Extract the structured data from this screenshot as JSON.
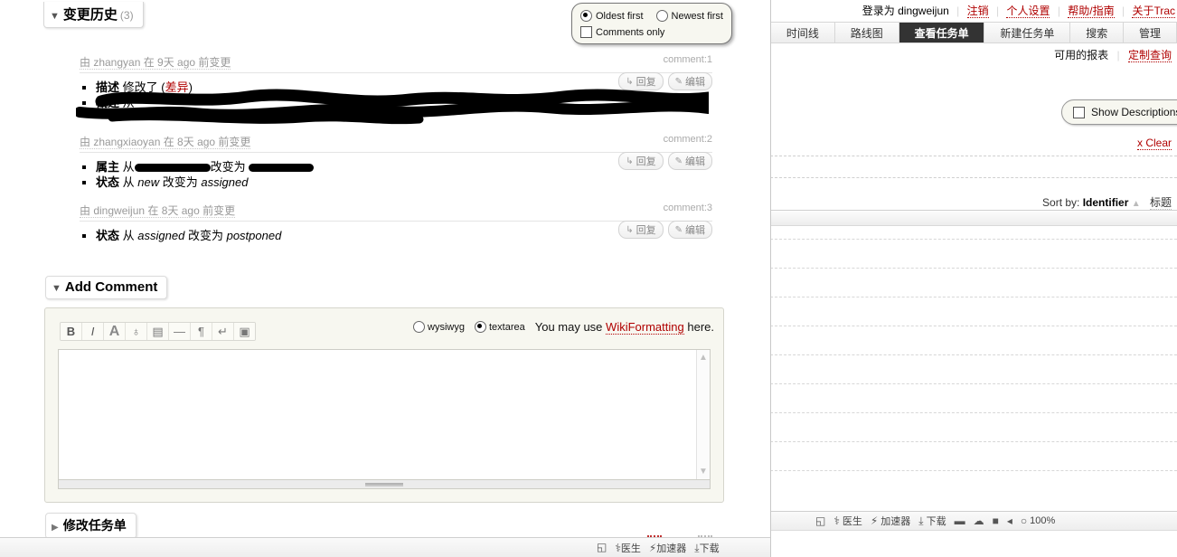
{
  "front_window": {
    "change_history": {
      "title": "变更历史",
      "count": "(3)",
      "toggle_icon": "triangle-down-icon"
    },
    "options_panel": {
      "oldest_first": "Oldest first",
      "newest_first": "Newest first",
      "comments_only": "Comments only",
      "oldest_selected": true,
      "newest_selected": false,
      "comments_only_checked": false
    },
    "reply_label": "回复",
    "edit_label": "编辑",
    "reply_icon": "reply-arrow-icon",
    "edit_icon": "pencil-icon",
    "changes": [
      {
        "header": "由 zhangyan 在 9天 ago 前变更",
        "author": "zhangyan",
        "comment_id": "comment:1",
        "entries": [
          {
            "field": "描述",
            "text": "修改了 (",
            "link": "差异",
            "text_after": ")"
          },
          {
            "field": "概述",
            "text": "从 ▓▓▓▓▓▓ 改变为 ▓▓▓▓▓▓",
            "redacted": true
          }
        ]
      },
      {
        "header": "由 zhangxiaoyan 在 8天 ago 前变更",
        "author": "zhangxiaoyan",
        "comment_id": "comment:2",
        "entries": [
          {
            "field": "属主",
            "text": "从 ▓▓▓▓▓▓ 改变为 ▓▓▓▓▓▓",
            "redacted": true
          },
          {
            "field": "状态",
            "from": "new",
            "to": "assigned",
            "mid": "改变为",
            "prefix": "从"
          }
        ]
      },
      {
        "header": "由 dingweijun 在 8天 ago 前变更",
        "author": "dingweijun",
        "comment_id": "comment:3",
        "entries": [
          {
            "field": "状态",
            "from": "assigned",
            "to": "postponed",
            "mid": "改变为",
            "prefix": "从"
          }
        ]
      }
    ],
    "add_comment": {
      "title": "Add Comment",
      "toggle_icon": "triangle-down-icon",
      "toolbar": [
        {
          "name": "bold-icon",
          "glyph": "B"
        },
        {
          "name": "italic-icon",
          "glyph": "I"
        },
        {
          "name": "heading-icon",
          "glyph": "A"
        },
        {
          "name": "link-globe-icon",
          "glyph": "♁"
        },
        {
          "name": "code-block-icon",
          "glyph": "▤"
        },
        {
          "name": "horizontal-rule-icon",
          "glyph": "—"
        },
        {
          "name": "paragraph-icon",
          "glyph": "¶"
        },
        {
          "name": "line-break-icon",
          "glyph": "↵"
        },
        {
          "name": "image-icon",
          "glyph": "▣"
        }
      ],
      "wysiwyg_label": "wysiwyg",
      "textarea_label": "textarea",
      "mode_selected": "textarea",
      "note_before": "You may use",
      "note_link": "WikiFormatting",
      "note_after": "here.",
      "textarea_value": "",
      "scroll_up_icon": "chevron-up-icon",
      "scroll_down_icon": "chevron-down-icon"
    },
    "modify_ticket": {
      "title": "修改任务单",
      "toggle_icon": "triangle-right-icon"
    },
    "status_bar": {
      "items": [
        {
          "name": "bookmark-icon",
          "glyph": "◱",
          "label": ""
        },
        {
          "name": "doctor-icon",
          "glyph": "⚕",
          "label": "医生"
        },
        {
          "name": "accelerator-icon",
          "glyph": "⚡",
          "label": "加速器"
        },
        {
          "name": "download-icon",
          "glyph": "⤓",
          "label": "下载"
        }
      ]
    }
  },
  "background_window": {
    "meta_nav": {
      "logged_in_as": "登录为 dingweijun",
      "links": [
        "注销",
        "个人设置",
        "帮助/指南",
        "关于Trac"
      ]
    },
    "main_nav": {
      "items": [
        "时间线",
        "路线图",
        "查看任务单",
        "新建任务单",
        "搜索",
        "管理"
      ],
      "active": "查看任务单"
    },
    "context_nav": {
      "plain": "可用的报表",
      "link": "定制查询"
    },
    "show_descriptions": {
      "label": "Show Descriptions",
      "checked": false
    },
    "clear_label": "x Clear",
    "sort_by": {
      "prefix": "Sort by:",
      "column": "Identifier",
      "direction_icon": "sort-ascending-icon",
      "secondary": "标题"
    },
    "status_bar": {
      "items": [
        {
          "name": "bookmark-icon",
          "glyph": "◱",
          "label": ""
        },
        {
          "name": "doctor-icon",
          "glyph": "⚕",
          "label": "医生"
        },
        {
          "name": "accelerator-icon",
          "glyph": "⚡",
          "label": "加速器"
        },
        {
          "name": "download-icon",
          "glyph": "⤓",
          "label": "下载"
        },
        {
          "name": "glasses-icon",
          "glyph": "▬",
          "label": ""
        },
        {
          "name": "cloud-icon",
          "glyph": "☁",
          "label": ""
        },
        {
          "name": "window-icon",
          "glyph": "■",
          "label": ""
        },
        {
          "name": "volume-icon",
          "glyph": "◂",
          "label": ""
        },
        {
          "name": "zoom-level",
          "glyph": "○",
          "label": "100%"
        }
      ]
    }
  },
  "colors": {
    "accent_red": "#b00000",
    "active_tab_bg": "#333333",
    "panel_bg": "#f7f7f0",
    "muted_text": "#999999"
  }
}
